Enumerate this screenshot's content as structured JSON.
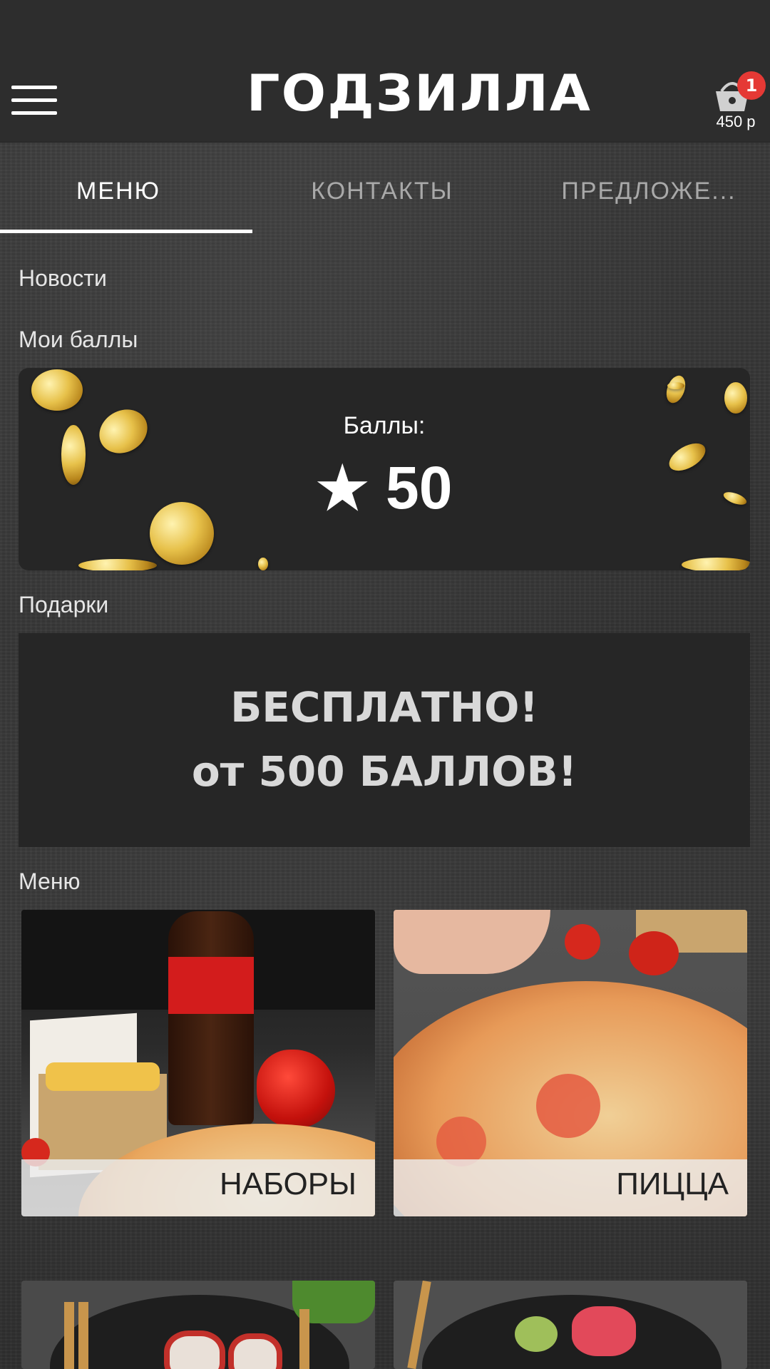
{
  "header": {
    "logo_text": "ГОДЗИЛЛА",
    "cart": {
      "badge": "1",
      "price": "450 р"
    }
  },
  "tabs": [
    {
      "label": "МЕНЮ",
      "active": true
    },
    {
      "label": "КОНТАКТЫ",
      "active": false
    },
    {
      "label": "ПРЕДЛОЖЕ...",
      "active": false
    }
  ],
  "sections": {
    "news": "Новости",
    "my_points": "Мои баллы",
    "gifts": "Подарки",
    "menu": "Меню"
  },
  "points_card": {
    "title": "Баллы:",
    "star": "★",
    "value": "50"
  },
  "gift_banner": {
    "line1": "БЕСПЛАТНО!",
    "line2": "от 500 БАЛЛОВ!"
  },
  "menu_items": [
    {
      "label": "НАБОРЫ"
    },
    {
      "label": "ПИЦЦА"
    },
    {
      "label": ""
    },
    {
      "label": ""
    }
  ],
  "colors": {
    "background": "#333333",
    "header": "#2d2d2d",
    "badge": "#e53935",
    "card": "#262626"
  }
}
